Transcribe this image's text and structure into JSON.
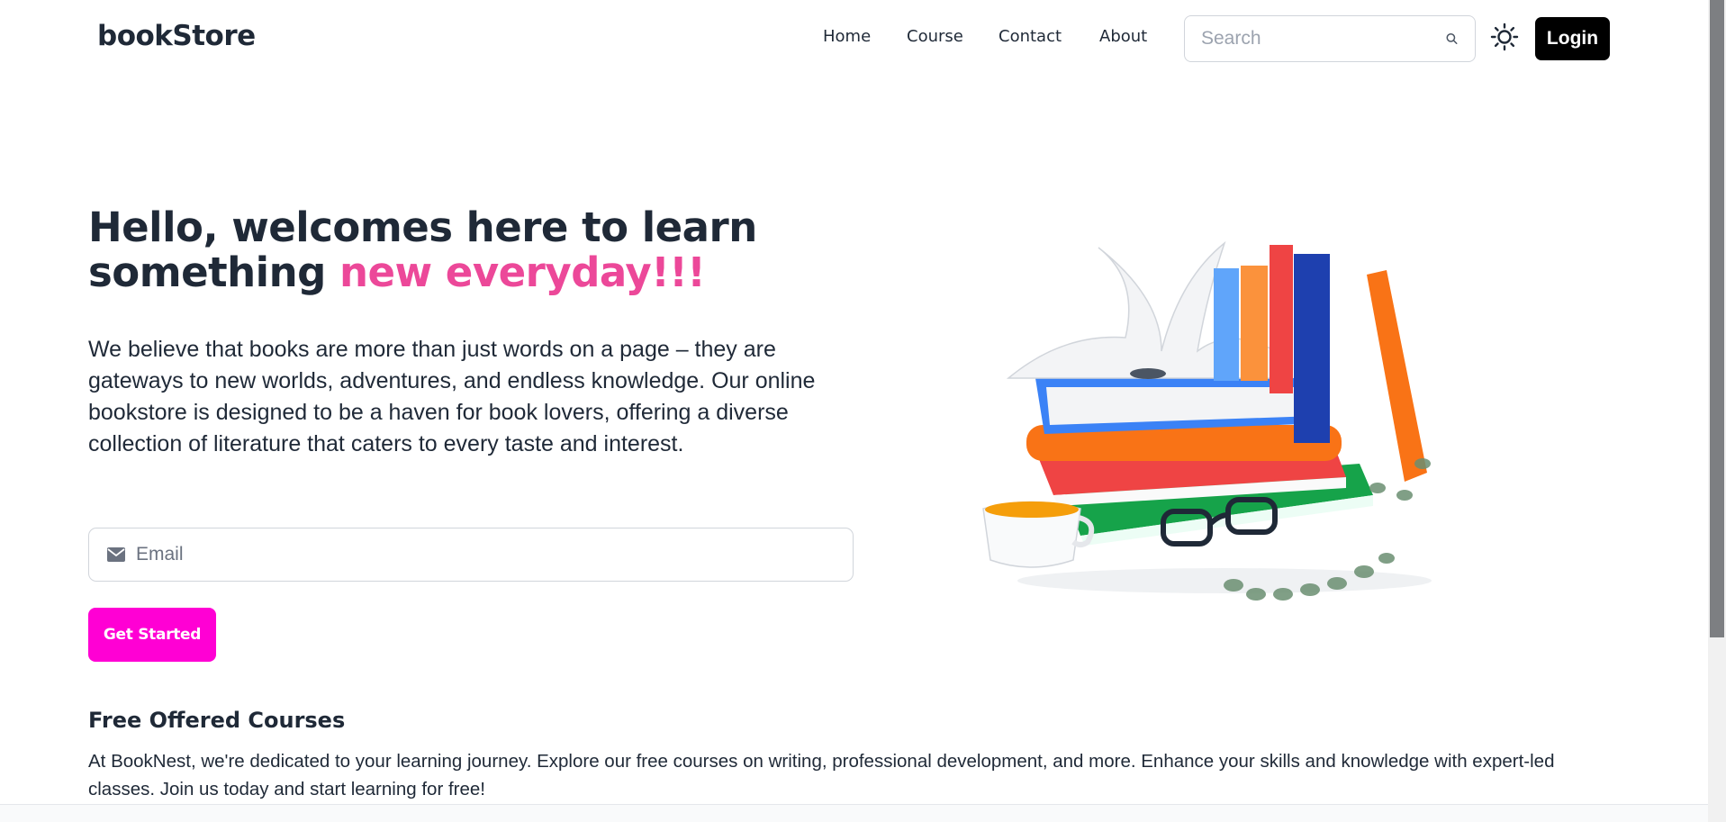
{
  "navbar": {
    "logo": "bookStore",
    "links": [
      "Home",
      "Course",
      "Contact",
      "About"
    ],
    "search_placeholder": "Search",
    "login_label": "Login"
  },
  "hero": {
    "title_part1": "Hello, welcomes here to learn something ",
    "title_accent": "new everyday!!!",
    "description": "We believe that books are more than just words on a page – they are gateways to new worlds, adventures, and endless knowledge. Our online bookstore is designed to be a haven for book lovers, offering a diverse collection of literature that caters to every taste and interest.",
    "email_placeholder": "Email",
    "cta_label": "Get Started"
  },
  "courses": {
    "title": "Free Offered Courses",
    "description": "At BookNest, we're dedicated to your learning journey. Explore our free courses on writing, professional development, and more. Enhance your skills and knowledge with expert-led classes. Join us today and start learning for free!"
  },
  "colors": {
    "accent_pink": "#ec4899",
    "cta_magenta": "#ff00d4",
    "login_black": "#000000"
  },
  "icons": [
    "search-icon",
    "sun-icon",
    "mail-icon"
  ]
}
